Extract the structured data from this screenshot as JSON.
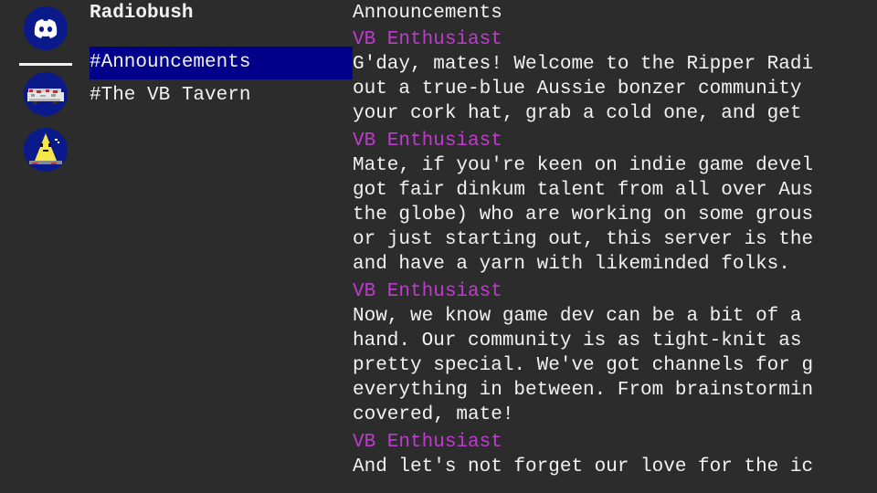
{
  "server": {
    "name": "Radiobush"
  },
  "servers": [
    {
      "icon": "discord-logo-icon"
    },
    {
      "icon": "pixel-vehicle-icon"
    },
    {
      "icon": "pixel-triangle-character-icon"
    }
  ],
  "channels": [
    {
      "label": "#Announcements",
      "selected": true
    },
    {
      "label": "#The VB Tavern",
      "selected": false
    }
  ],
  "channel_header": "Announcements",
  "messages": [
    {
      "author": "VB Enthusiast",
      "lines": [
        "G'day, mates! Welcome to the Ripper Radi",
        "out a true-blue Aussie bonzer community",
        "your cork hat, grab a cold one, and get"
      ]
    },
    {
      "author": "VB Enthusiast",
      "lines": [
        "Mate, if you're keen on indie game devel",
        "got fair dinkum talent from all over Aus",
        "the globe) who are working on some grous",
        "or just starting out, this server is the",
        "and have a yarn with likeminded folks."
      ]
    },
    {
      "author": "VB Enthusiast",
      "lines": [
        "Now, we know game dev can be a bit of a",
        "hand. Our community is as tight-knit as",
        "pretty special. We've got channels for g",
        "everything in between. From brainstormin",
        "covered, mate!"
      ]
    },
    {
      "author": "VB Enthusiast",
      "lines": [
        "And let's not forget our love for the ic",
        "                       ,"
      ]
    }
  ],
  "colors": {
    "background": "#2c2c2c",
    "text": "#f2f2f2",
    "author": "#c13ad0",
    "selected_channel": "#00008b",
    "server_icon_bg": "#0a1a8a"
  }
}
